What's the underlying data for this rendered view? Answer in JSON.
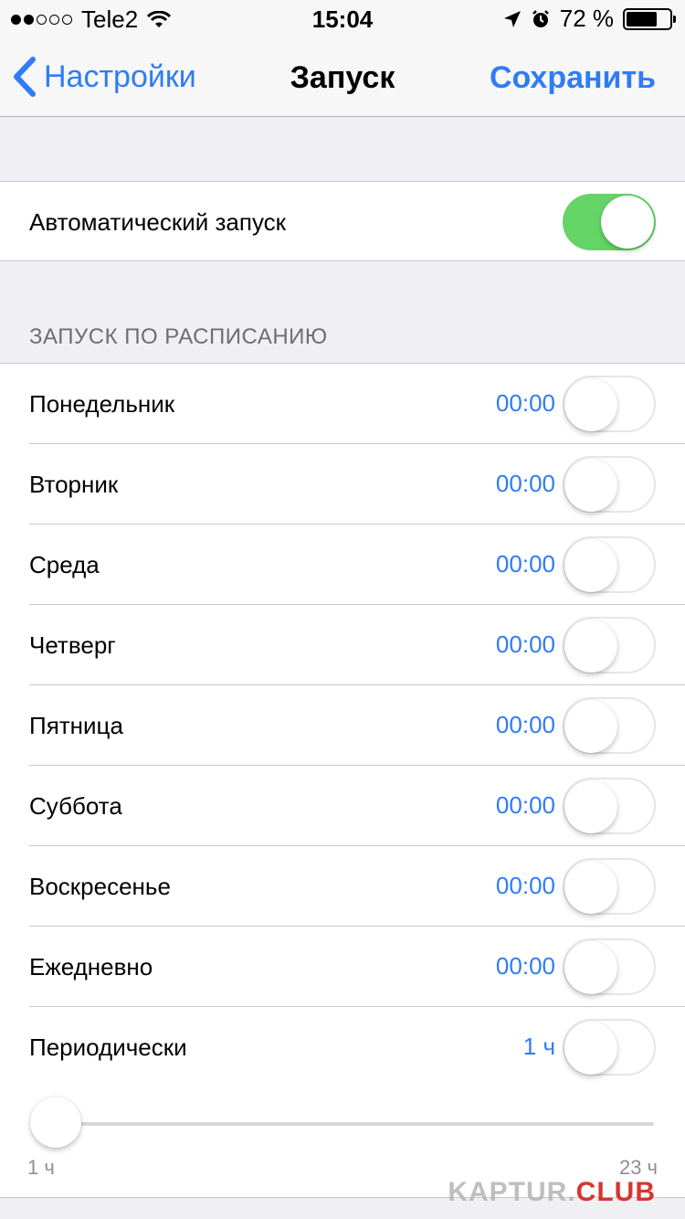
{
  "status_bar": {
    "carrier": "Tele2",
    "time": "15:04",
    "battery": "72 %",
    "signal_strength": 2,
    "signal_total": 5
  },
  "nav": {
    "back_label": "Настройки",
    "title": "Запуск",
    "save_label": "Сохранить"
  },
  "auto_launch": {
    "label": "Автоматический запуск",
    "enabled": true
  },
  "schedule": {
    "header": "ЗАПУСК ПО РАСПИСАНИЮ",
    "rows": [
      {
        "label": "Понедельник",
        "time": "00:00",
        "enabled": false
      },
      {
        "label": "Вторник",
        "time": "00:00",
        "enabled": false
      },
      {
        "label": "Среда",
        "time": "00:00",
        "enabled": false
      },
      {
        "label": "Четверг",
        "time": "00:00",
        "enabled": false
      },
      {
        "label": "Пятница",
        "time": "00:00",
        "enabled": false
      },
      {
        "label": "Суббота",
        "time": "00:00",
        "enabled": false
      },
      {
        "label": "Воскресенье",
        "time": "00:00",
        "enabled": false
      },
      {
        "label": "Ежедневно",
        "time": "00:00",
        "enabled": false
      },
      {
        "label": "Периодически",
        "time": "1 ч",
        "enabled": false
      }
    ]
  },
  "slider": {
    "min_label": "1 ч",
    "max_label": "23 ч",
    "value": 1
  },
  "watermark": {
    "part1": "KAPTUR.",
    "part2": "CLUB"
  },
  "colors": {
    "accent": "#2f7cf6",
    "switch_on": "#64d466"
  }
}
